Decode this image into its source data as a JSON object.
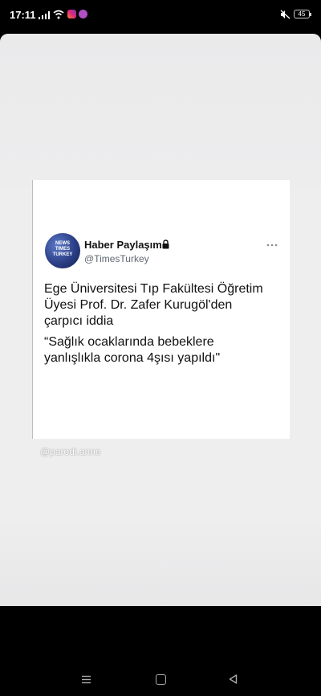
{
  "status_bar": {
    "time": "17:11",
    "battery": "45",
    "icons": [
      "signal-icon",
      "wifi-icon",
      "instagram-icon",
      "app-icon",
      "mute-icon",
      "battery-icon"
    ]
  },
  "tweet": {
    "display_name": "Haber Paylaşım",
    "handle": "@TimesTurkey",
    "avatar_text": [
      "NEWS",
      "TIMES",
      "TURKEY"
    ],
    "locked": true,
    "body_lines": [
      "Ege Üniversitesi Tıp Fakültesi Öğretim",
      "Üyesi Prof. Dr. Zafer Kurugöl'den",
      "çarpıcı iddia"
    ],
    "quote_lines": [
      "“Sağlık ocaklarında bebeklere",
      "yanlışlıkla corona 4şısı yapıldı\""
    ]
  },
  "watermark": "@parodi.anne",
  "nav_bar": {
    "icons": [
      "menu-icon",
      "home-icon",
      "back-icon"
    ]
  },
  "colors": {
    "story_background": "#eeeeef",
    "card_background": "#ffffff",
    "avatar_blue": "#2b3f86",
    "screen_background": "#000000"
  }
}
